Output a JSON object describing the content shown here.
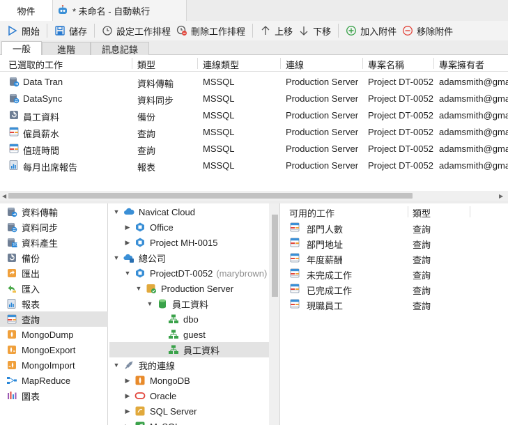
{
  "document_tabs": [
    {
      "label": "物件"
    },
    {
      "label": "* 未命名 - 自動執行"
    }
  ],
  "toolbar": {
    "start": "開始",
    "save": "儲存",
    "set_schedule": "設定工作排程",
    "delete_schedule": "刪除工作排程",
    "move_up": "上移",
    "move_down": "下移",
    "add_attachment": "加入附件",
    "remove_attachment": "移除附件"
  },
  "sub_tabs": [
    {
      "label": "一般"
    },
    {
      "label": "進階"
    },
    {
      "label": "訊息記錄"
    }
  ],
  "grid": {
    "headers": [
      "已選取的工作",
      "類型",
      "連線類型",
      "連線",
      "專案名稱",
      "專案擁有者"
    ],
    "rows": [
      {
        "icon": "data-transfer-icon",
        "name": "Data Tran",
        "type": "資料傳輸",
        "conn_type": "MSSQL",
        "connection": "Production Server",
        "project": "Project DT-0052",
        "owner": "adamsmith@gma"
      },
      {
        "icon": "data-sync-icon",
        "name": "DataSync",
        "type": "資料同步",
        "conn_type": "MSSQL",
        "connection": "Production Server",
        "project": "Project DT-0052",
        "owner": "adamsmith@gma"
      },
      {
        "icon": "backup-icon",
        "name": "員工資料",
        "type": "備份",
        "conn_type": "MSSQL",
        "connection": "Production Server",
        "project": "Project DT-0052",
        "owner": "adamsmith@gma"
      },
      {
        "icon": "query-icon",
        "name": "僱員薪水",
        "type": "查詢",
        "conn_type": "MSSQL",
        "connection": "Production Server",
        "project": "Project DT-0052",
        "owner": "adamsmith@gma"
      },
      {
        "icon": "query-icon",
        "name": "值班時間",
        "type": "查詢",
        "conn_type": "MSSQL",
        "connection": "Production Server",
        "project": "Project DT-0052",
        "owner": "adamsmith@gma"
      },
      {
        "icon": "report-icon",
        "name": "每月出席報告",
        "type": "報表",
        "conn_type": "MSSQL",
        "connection": "Production Server",
        "project": "Project DT-0052",
        "owner": "adamsmith@gma"
      }
    ]
  },
  "job_types": [
    {
      "label": "資料傳輸",
      "icon": "data-transfer-icon"
    },
    {
      "label": "資料同步",
      "icon": "data-sync-icon"
    },
    {
      "label": "資料產生",
      "icon": "data-generation-icon"
    },
    {
      "label": "備份",
      "icon": "backup-icon"
    },
    {
      "label": "匯出",
      "icon": "export-icon"
    },
    {
      "label": "匯入",
      "icon": "import-icon"
    },
    {
      "label": "報表",
      "icon": "report-icon"
    },
    {
      "label": "查詢",
      "icon": "query-icon"
    },
    {
      "label": "MongoDump",
      "icon": "mongodump-icon"
    },
    {
      "label": "MongoExport",
      "icon": "mongoexport-icon"
    },
    {
      "label": "MongoImport",
      "icon": "mongoimport-icon"
    },
    {
      "label": "MapReduce",
      "icon": "mapreduce-icon"
    },
    {
      "label": "圖表",
      "icon": "chart-icon"
    }
  ],
  "tree": [
    {
      "label": "Navicat Cloud",
      "icon": "cloud-icon",
      "expanded": true
    },
    {
      "label": "Office",
      "icon": "project-icon",
      "expanded": false
    },
    {
      "label": "Project MH-0015",
      "icon": "project-icon",
      "expanded": false
    },
    {
      "label": "總公司",
      "icon": "cloud-group-icon",
      "expanded": true
    },
    {
      "label": "ProjectDT-0052",
      "owner": "(marybrown)",
      "icon": "project-icon",
      "expanded": true
    },
    {
      "label": "Production Server",
      "icon": "mssql-server-icon",
      "expanded": true
    },
    {
      "label": "員工資料",
      "icon": "database-icon",
      "expanded": true
    },
    {
      "label": "dbo",
      "icon": "schema-icon"
    },
    {
      "label": "guest",
      "icon": "schema-icon"
    },
    {
      "label": "員工資料",
      "icon": "schema-icon"
    },
    {
      "label": "我的連線",
      "icon": "connection-icon",
      "expanded": true
    },
    {
      "label": "MongoDB",
      "icon": "mongodb-icon",
      "expanded": false
    },
    {
      "label": "Oracle",
      "icon": "oracle-icon",
      "expanded": false
    },
    {
      "label": "SQL Server",
      "icon": "sqlserver-icon",
      "expanded": false
    },
    {
      "label": "MySQL",
      "icon": "mysql-icon",
      "expanded": false
    }
  ],
  "available": {
    "headers": [
      "可用的工作",
      "類型"
    ],
    "rows": [
      {
        "name": "部門人數",
        "type": "查詢"
      },
      {
        "name": "部門地址",
        "type": "查詢"
      },
      {
        "name": "年度薪酬",
        "type": "查詢"
      },
      {
        "name": "未完成工作",
        "type": "查詢"
      },
      {
        "name": "已完成工作",
        "type": "查詢"
      },
      {
        "name": "現職員工",
        "type": "查詢"
      }
    ]
  }
}
